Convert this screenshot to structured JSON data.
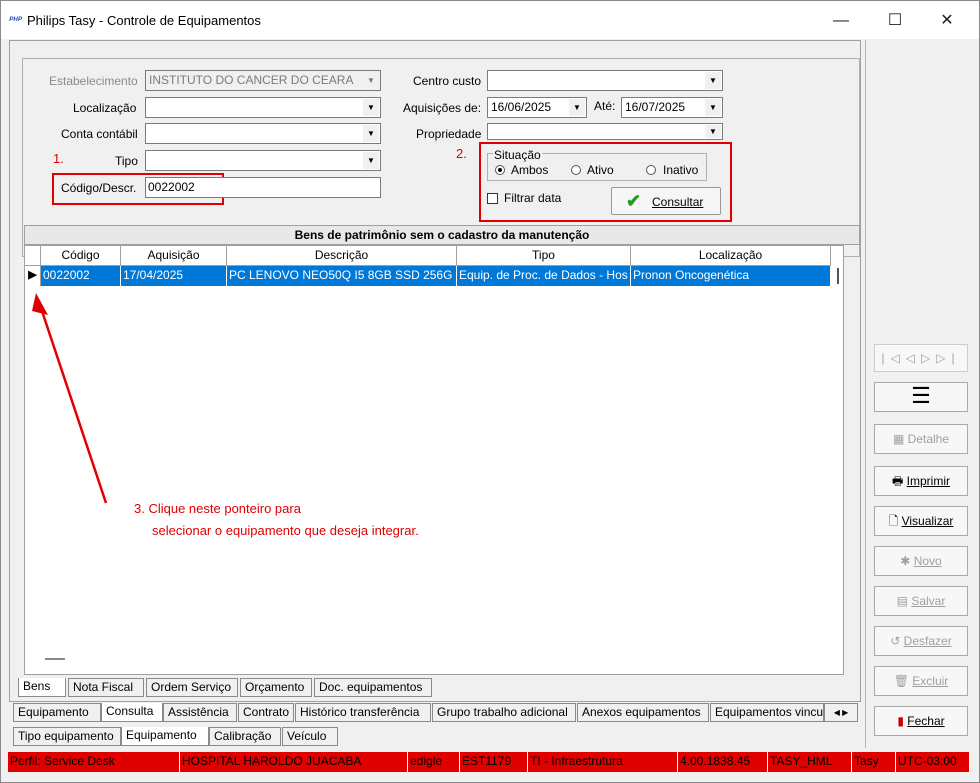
{
  "window": {
    "title": "Philips Tasy - Controle de Equipamentos",
    "logo": "ᴾᴴᴾ"
  },
  "filters": {
    "estabelecimento_label": "Estabelecimento",
    "estabelecimento_value": "INSTITUTO DO CANCER DO CEARA",
    "localizacao_label": "Localização",
    "conta_label": "Conta contábil",
    "tipo_label": "Tipo",
    "codigo_label": "Código/Descr.",
    "codigo_value": "0022002",
    "centro_label": "Centro custo",
    "aquisicoes_label": "Aquisições de:",
    "aquisicoes_de": "16/06/2025",
    "ate_label": "Até:",
    "ate_value": "16/07/2025",
    "propriedade_label": "Propriedade",
    "situacao_label": "Situação",
    "ambos": "Ambos",
    "ativo": "Ativo",
    "inativo": "Inativo",
    "filtrar_data": "Filtrar data",
    "consultar": "Consultar"
  },
  "annotations": {
    "step1": "1.",
    "step2": "2.",
    "step3_line1": "3. Clique neste ponteiro para",
    "step3_line2": "selecionar o equipamento que deseja integrar."
  },
  "grid": {
    "title": "Bens de patrimônio sem o cadastro da manutenção",
    "columns": [
      "Código",
      "Aquisição",
      "Descrição",
      "Tipo",
      "Localização"
    ],
    "rows": [
      [
        "0022002",
        "17/04/2025",
        "PC LENOVO NEO50Q I5 8GB SSD 256G",
        "Equip. de Proc. de Dados - Hos",
        "Pronon Oncogenética"
      ]
    ],
    "pointer": "▶"
  },
  "tabs_row1": [
    "Bens",
    "Nota Fiscal",
    "Ordem Serviço",
    "Orçamento",
    "Doc. equipamentos"
  ],
  "tabs_row2": [
    "Equipamento",
    "Consulta",
    "Assistência",
    "Contrato",
    "Histórico transferência",
    "Grupo trabalho adicional",
    "Anexos equipamentos",
    "Equipamentos vincu"
  ],
  "tabs_row3": [
    "Tipo equipamento",
    "Equipamento",
    "Calibração",
    "Veículo"
  ],
  "side_buttons": {
    "detalhe": "Detalhe",
    "imprimir": "Imprimir",
    "visualizar": "Visualizar",
    "novo": "Novo",
    "salvar": "Salvar",
    "desfazer": "Desfazer",
    "excluir": "Excluir",
    "fechar": "Fechar"
  },
  "status_bar": [
    "Perfil: Service Desk",
    "HOSPITAL HAROLDO JUACABA",
    "edigle",
    "EST1179",
    "TI - Infraestrutura",
    "4.00.1838.45",
    "TASY_HML",
    "Tasy",
    "UTC-03:00"
  ],
  "colors": {
    "selection": "#0078d7",
    "annotation": "#e00000"
  }
}
